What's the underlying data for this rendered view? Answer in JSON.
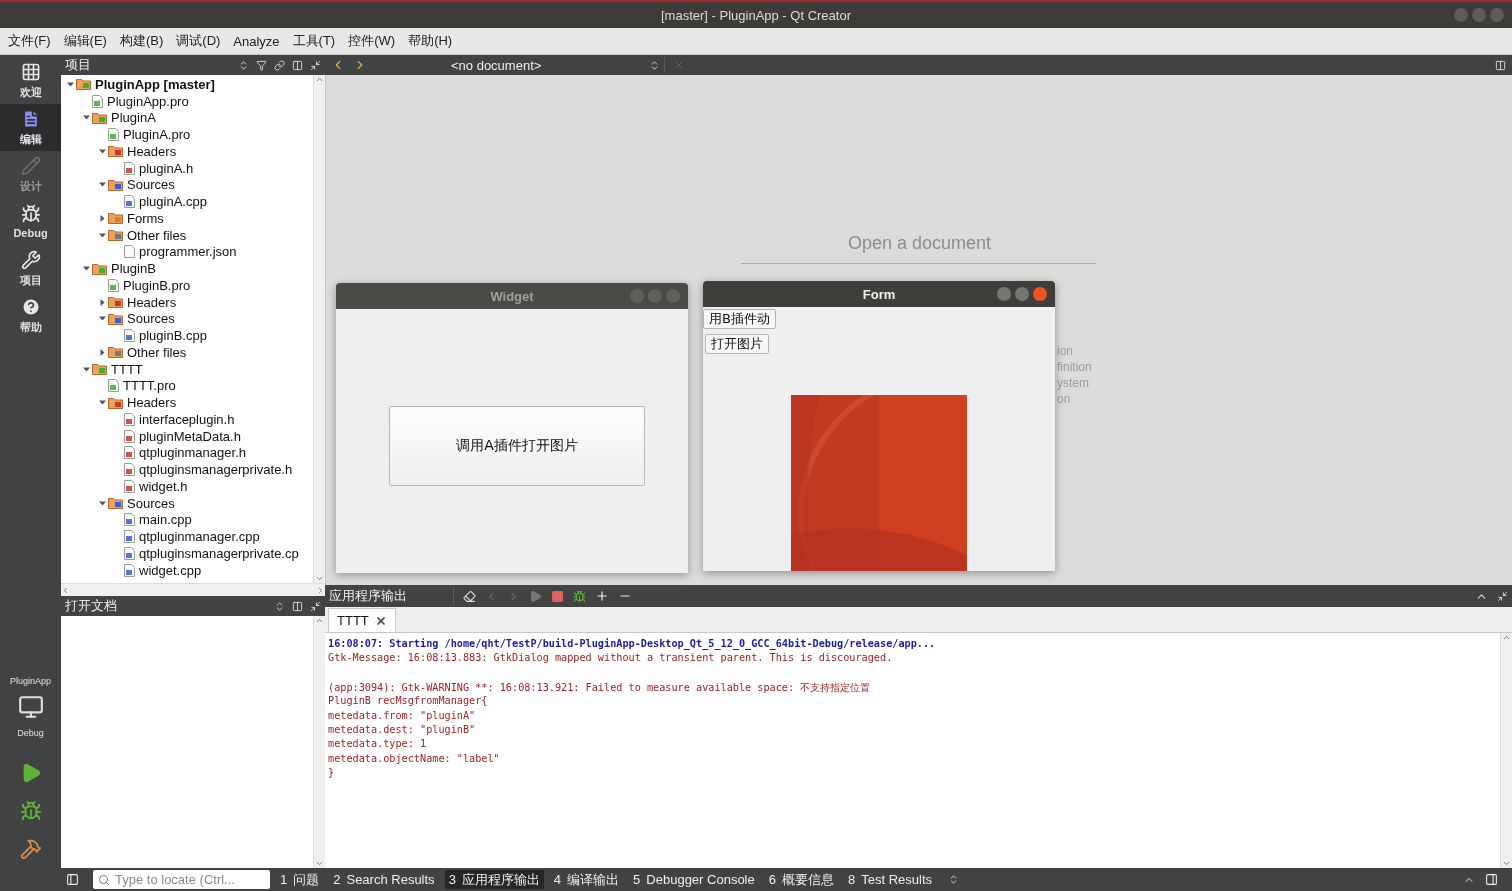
{
  "window": {
    "title": "[master] - PluginApp - Qt Creator"
  },
  "menu": [
    "文件(F)",
    "编辑(E)",
    "构建(B)",
    "调试(D)",
    "Analyze",
    "工具(T)",
    "控件(W)",
    "帮助(H)"
  ],
  "mode_bar": {
    "modes": [
      {
        "kind": "welcome",
        "label": "欢迎",
        "selected": false,
        "disabled": false
      },
      {
        "kind": "edit",
        "label": "编辑",
        "selected": true,
        "disabled": false
      },
      {
        "kind": "design",
        "label": "设计",
        "selected": false,
        "disabled": true
      },
      {
        "kind": "debug",
        "label": "Debug",
        "selected": false,
        "disabled": false
      },
      {
        "kind": "projects",
        "label": "项目",
        "selected": false,
        "disabled": false
      },
      {
        "kind": "help",
        "label": "帮助",
        "selected": false,
        "disabled": false
      }
    ],
    "target": {
      "project": "PluginApp",
      "config": "Debug"
    }
  },
  "project_panel": {
    "title": "项目",
    "items": [
      {
        "label": "PluginApp [master]",
        "kind": "project",
        "bold": true,
        "expanded": true,
        "children": [
          {
            "label": "PluginApp.pro",
            "kind": "pro"
          },
          {
            "label": "PluginA",
            "kind": "project",
            "expanded": true,
            "children": [
              {
                "label": "PluginA.pro",
                "kind": "pro"
              },
              {
                "label": "Headers",
                "kind": "headers",
                "expanded": true,
                "children": [
                  {
                    "label": "pluginA.h",
                    "kind": "h"
                  }
                ]
              },
              {
                "label": "Sources",
                "kind": "sources",
                "expanded": true,
                "children": [
                  {
                    "label": "pluginA.cpp",
                    "kind": "cpp"
                  }
                ]
              },
              {
                "label": "Forms",
                "kind": "forms",
                "expanded": false
              },
              {
                "label": "Other files",
                "kind": "other",
                "expanded": true,
                "children": [
                  {
                    "label": "programmer.json",
                    "kind": "file"
                  }
                ]
              }
            ]
          },
          {
            "label": "PluginB",
            "kind": "project",
            "expanded": true,
            "children": [
              {
                "label": "PluginB.pro",
                "kind": "pro"
              },
              {
                "label": "Headers",
                "kind": "headers",
                "expanded": false
              },
              {
                "label": "Sources",
                "kind": "sources",
                "expanded": true,
                "children": [
                  {
                    "label": "pluginB.cpp",
                    "kind": "cpp"
                  }
                ]
              },
              {
                "label": "Other files",
                "kind": "other",
                "expanded": false
              }
            ]
          },
          {
            "label": "TTTT",
            "kind": "project",
            "expanded": true,
            "children": [
              {
                "label": "TTTT.pro",
                "kind": "pro"
              },
              {
                "label": "Headers",
                "kind": "headers",
                "expanded": true,
                "children": [
                  {
                    "label": "interfaceplugin.h",
                    "kind": "h"
                  },
                  {
                    "label": "pluginMetaData.h",
                    "kind": "h"
                  },
                  {
                    "label": "qtpluginmanager.h",
                    "kind": "h"
                  },
                  {
                    "label": "qtpluginsmanagerprivate.h",
                    "kind": "h"
                  },
                  {
                    "label": "widget.h",
                    "kind": "h"
                  }
                ]
              },
              {
                "label": "Sources",
                "kind": "sources",
                "expanded": true,
                "children": [
                  {
                    "label": "main.cpp",
                    "kind": "cpp"
                  },
                  {
                    "label": "qtpluginmanager.cpp",
                    "kind": "cpp"
                  },
                  {
                    "label": "qtpluginsmanagerprivate.cp",
                    "kind": "cpp"
                  },
                  {
                    "label": "widget.cpp",
                    "kind": "cpp"
                  }
                ]
              }
            ]
          }
        ]
      }
    ]
  },
  "open_documents": {
    "title": "打开文档"
  },
  "editor": {
    "document": "<no document>",
    "welcome_title": "Open a document",
    "hidden_hints": [
      "ion",
      "finition",
      "ystem",
      "on"
    ]
  },
  "windows": [
    {
      "title": "Widget",
      "active": false,
      "buttons": [
        "调用A插件打开图片"
      ]
    },
    {
      "title": "Form",
      "active": true,
      "buttons": [
        "用B插件动",
        "打开图片"
      ],
      "image": {
        "kind": "picture"
      }
    }
  ],
  "output": {
    "title": "应用程序输出",
    "tabs": [
      {
        "label": "TTTT",
        "selected": true
      }
    ],
    "lines": [
      {
        "kind": "start",
        "text": "16:08:07: Starting /home/qht/TestP/build-PluginApp-Desktop_Qt_5_12_0_GCC_64bit-Debug/release/app..."
      },
      {
        "kind": "stderr",
        "text": "Gtk-Message: 16:08:13.883: GtkDialog mapped without a transient parent. This is discouraged."
      },
      {
        "kind": "gap"
      },
      {
        "kind": "stderr",
        "text": "(app:3094): Gtk-WARNING **: 16:08:13.921: Failed to measure available space: 不支持指定位置"
      },
      {
        "kind": "stderr",
        "text": "PluginB recMsgfromManager{"
      },
      {
        "kind": "stderr",
        "text": "metedata.from: \"pluginA\""
      },
      {
        "kind": "stderr",
        "text": "metedata.dest: \"pluginB\""
      },
      {
        "kind": "stderr",
        "text": "metedata.type: 1"
      },
      {
        "kind": "stderr",
        "text": "metedata.objectName: \"label\""
      },
      {
        "kind": "stderr",
        "text": "}"
      }
    ]
  },
  "status_bar": {
    "locator": {
      "placeholder": "Type to locate (Ctrl..."
    },
    "tabs": [
      {
        "number": "1",
        "label": "问题",
        "selected": false
      },
      {
        "number": "2",
        "label": "Search Results",
        "selected": false
      },
      {
        "number": "3",
        "label": "应用程序输出",
        "selected": true
      },
      {
        "number": "4",
        "label": "编译输出",
        "selected": false
      },
      {
        "number": "5",
        "label": "Debugger Console",
        "selected": false
      },
      {
        "number": "6",
        "label": "概要信息",
        "selected": false
      },
      {
        "number": "8",
        "label": "Test Results",
        "selected": false
      }
    ]
  }
}
